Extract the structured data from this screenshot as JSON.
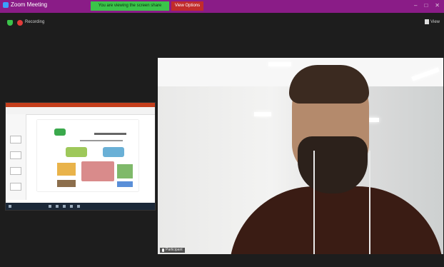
{
  "window": {
    "title": "Zoom Meeting",
    "controls": [
      "–",
      "□",
      "✕"
    ]
  },
  "share_banner": {
    "text": "You are viewing the screen share",
    "stop_label": "View Options"
  },
  "toolbar": {
    "recording_label": "Recording",
    "view_label": "View"
  },
  "participant": {
    "name": "Participant"
  },
  "icons": [
    "shield-icon",
    "record-dot-icon",
    "view-icon",
    "mic-icon"
  ],
  "colors": {
    "titlebar": "#8a1c87",
    "banner": "#3bc44a",
    "background": "#1d1d1d"
  }
}
